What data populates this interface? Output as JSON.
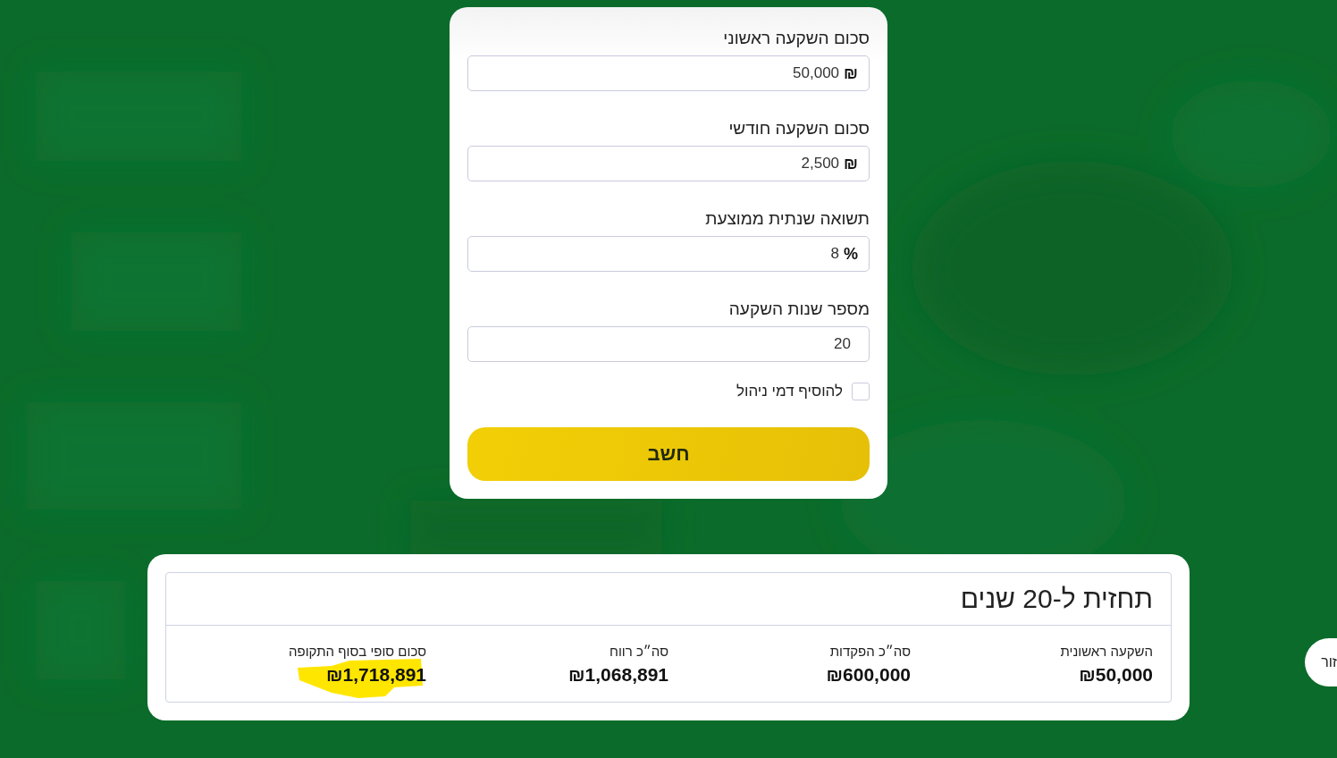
{
  "form": {
    "fields": [
      {
        "label": "סכום השקעה ראשוני",
        "value": "50,000",
        "unit": "₪"
      },
      {
        "label": "סכום השקעה חודשי",
        "value": "2,500",
        "unit": "₪"
      },
      {
        "label": "תשואה שנתית ממוצעת",
        "value": "8",
        "unit": "%"
      },
      {
        "label": "מספר שנות השקעה",
        "value": "20"
      }
    ],
    "checkbox": {
      "label": "להוסיף דמי ניהול",
      "checked": false
    },
    "button": "חשב"
  },
  "results": {
    "title": "תחזית ל-20 שנים",
    "items": [
      {
        "label": "השקעה ראשונית",
        "value": "₪50,000",
        "highlighted": false
      },
      {
        "label": "סה״כ הפקדות",
        "value": "₪600,000",
        "highlighted": false
      },
      {
        "label": "סה״כ רווח",
        "value": "₪1,068,891",
        "highlighted": false
      },
      {
        "label": "סכום סופי בסוף התקופה",
        "value": "₪1,718,891",
        "highlighted": true
      }
    ]
  },
  "side_button": "זור"
}
